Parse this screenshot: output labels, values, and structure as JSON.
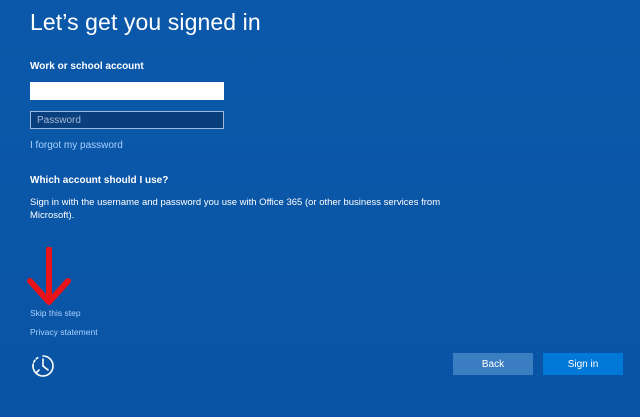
{
  "page": {
    "title": "Let’s get you signed in"
  },
  "form": {
    "account_label": "Work or school account",
    "account_value": "",
    "password_placeholder": "Password",
    "forgot_link": "I forgot my password"
  },
  "help": {
    "question": "Which account should I use?",
    "explanation": "Sign in with the username and password you use with Office 365 (or other business services from Microsoft)."
  },
  "footer": {
    "skip_link": "Skip this step",
    "privacy_link": "Privacy statement",
    "back_label": "Back",
    "signin_label": "Sign in"
  },
  "icons": {
    "annotation_arrow": "arrow-down-icon",
    "ease_of_access": "ease-of-access-icon"
  },
  "colors": {
    "background": "#0a55a6",
    "link": "#a9d2ff",
    "primary_button": "#0078d7",
    "secondary_button": "#3b7dc1",
    "annotation": "#e8141a"
  }
}
